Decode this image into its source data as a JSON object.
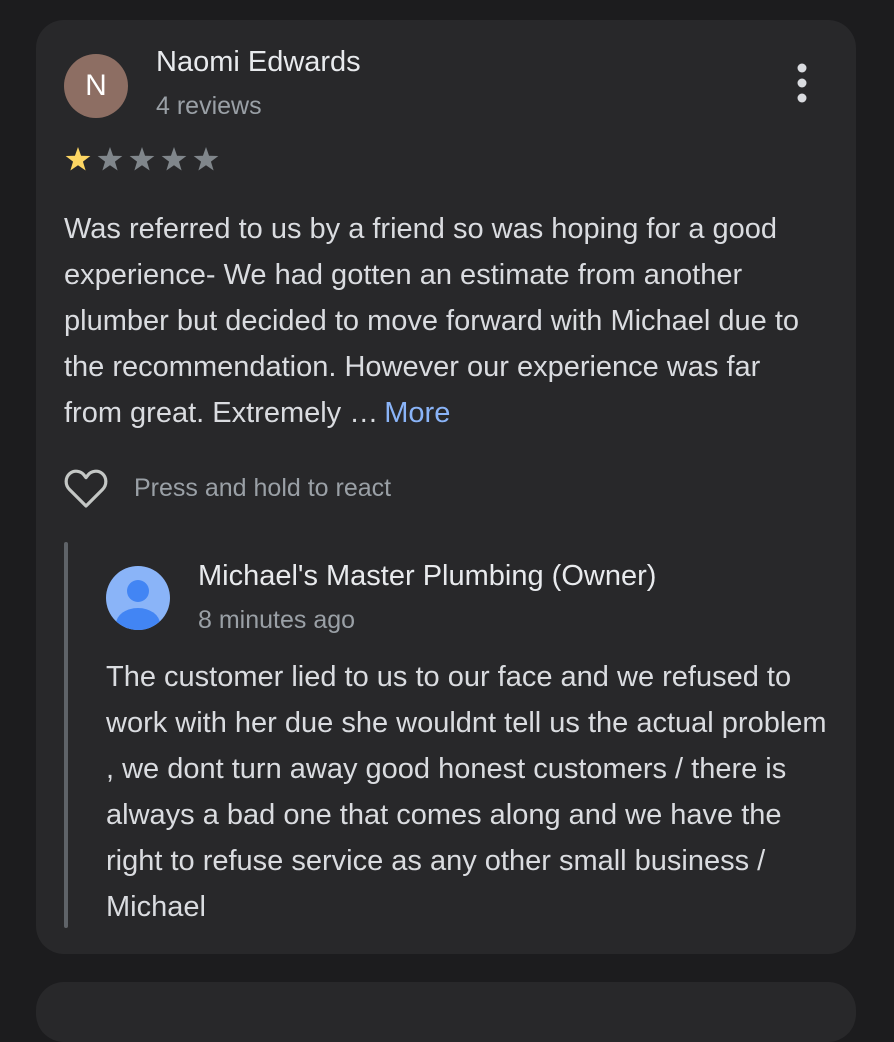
{
  "review": {
    "avatar_letter": "N",
    "avatar_color": "#8d6e63",
    "reviewer_name": "Naomi Edwards",
    "reviewer_meta": "4 reviews",
    "rating": 1,
    "rating_max": 5,
    "star_color_filled": "#fdd663",
    "star_color_empty": "#80868b",
    "text": "Was referred to us by a friend so was hoping for a good experience- We had gotten an estimate from another plumber but decided to move forward with Michael due to the recommendation. However our experience was far from great. Extremely …",
    "more_label": "More",
    "more_menu_icon": "more-vertical-icon",
    "react_icon": "heart-outline-icon",
    "react_label": "Press and hold to react"
  },
  "reply": {
    "owner_avatar_icon": "default-person-avatar-icon",
    "owner_avatar_color": "#8ab4f8",
    "owner_name": "Michael's Master Plumbing (Owner)",
    "owner_meta": "8 minutes ago",
    "text": "The customer lied to us to our face and we refused to work with her due she wouldnt tell us the actual problem , we dont turn away good honest customers / there is always a bad one that comes along and we have the right to refuse service as any other small business / Michael"
  },
  "colors": {
    "background": "#1c1c1e",
    "card": "#28282a",
    "link": "#8ab4f8"
  }
}
